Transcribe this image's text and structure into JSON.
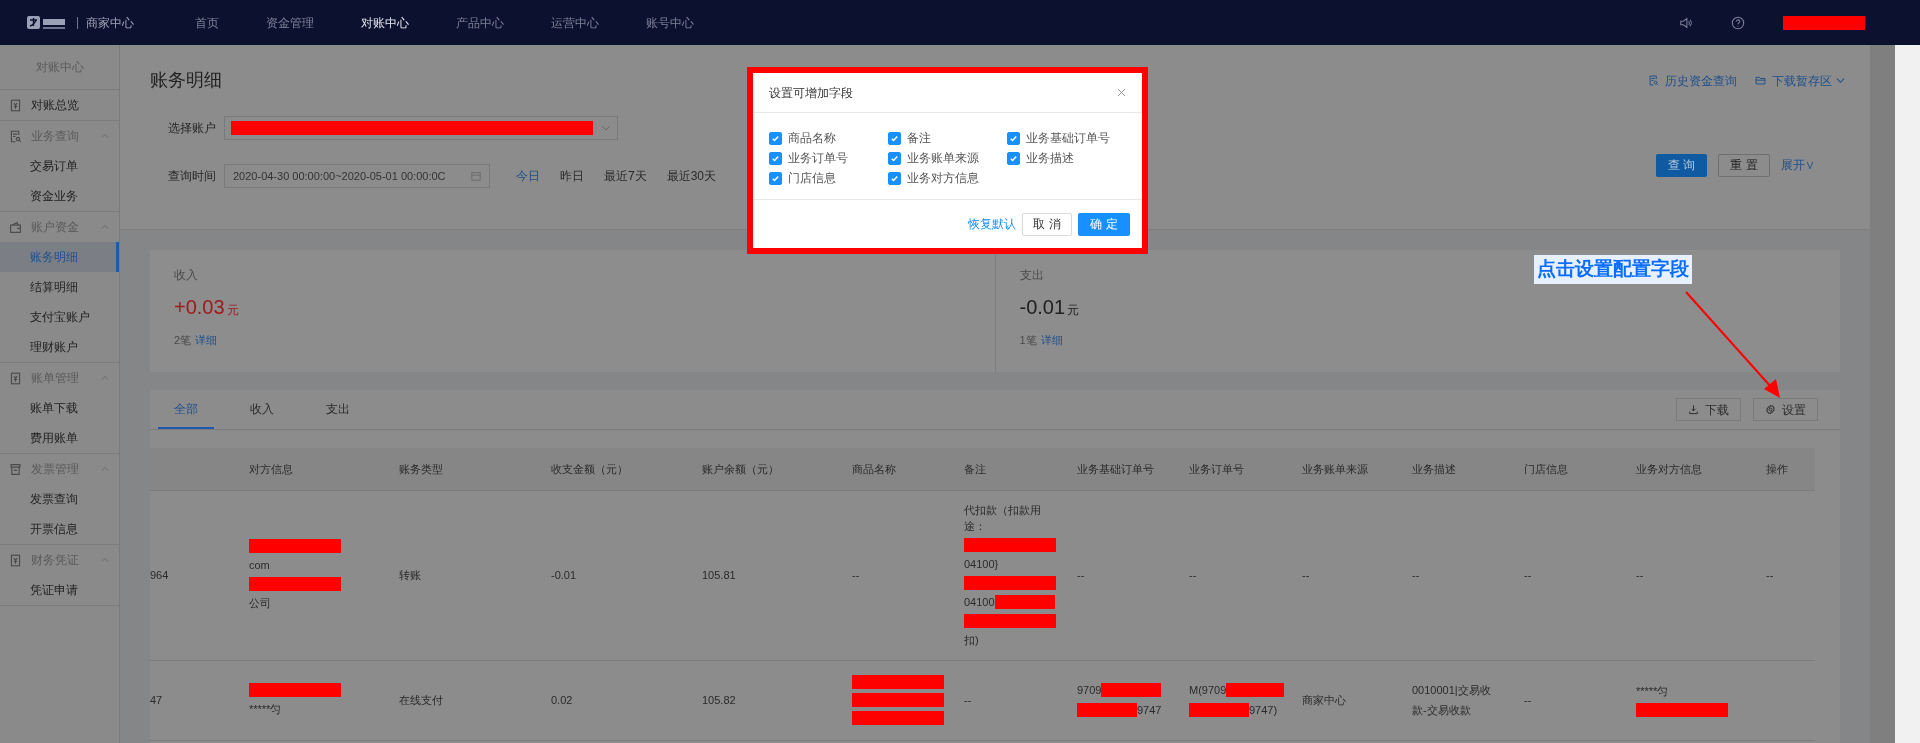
{
  "nav": {
    "brand": "商家中心",
    "items": [
      {
        "label": "首页",
        "selected": false
      },
      {
        "label": "资金管理",
        "selected": false
      },
      {
        "label": "对账中心",
        "selected": true
      },
      {
        "label": "产品中心",
        "selected": false
      },
      {
        "label": "运营中心",
        "selected": false
      },
      {
        "label": "账号中心",
        "selected": false
      }
    ],
    "user": {
      "kind": "redacted"
    }
  },
  "sidebar": {
    "title": "对账中心",
    "groups": [
      {
        "label": "对账总览"
      },
      {
        "label": "业务查询",
        "expanded": true,
        "children": [
          {
            "label": "交易订单",
            "selected": false
          },
          {
            "label": "资金业务",
            "selected": false
          }
        ]
      },
      {
        "label": "账户资金",
        "expanded": true,
        "children": [
          {
            "label": "账务明细",
            "selected": true
          },
          {
            "label": "结算明细",
            "selected": false
          },
          {
            "label": "支付宝账户",
            "selected": false
          },
          {
            "label": "理财账户",
            "selected": false
          }
        ]
      },
      {
        "label": "账单管理",
        "expanded": true,
        "children": [
          {
            "label": "账单下载",
            "selected": false
          },
          {
            "label": "费用账单",
            "selected": false
          }
        ]
      },
      {
        "label": "发票管理",
        "expanded": true,
        "children": [
          {
            "label": "发票查询",
            "selected": false
          },
          {
            "label": "开票信息",
            "selected": false
          }
        ]
      },
      {
        "label": "财务凭证",
        "expanded": true,
        "children": [
          {
            "label": "凭证申请",
            "selected": false
          }
        ]
      }
    ]
  },
  "page": {
    "title": "账务明细",
    "links": [
      {
        "label": "历史资金查询",
        "dropdown": false
      },
      {
        "label": "下载暂存区",
        "dropdown": true
      }
    ]
  },
  "filters": {
    "account_label": "选择账户",
    "account_value": {
      "kind": "redacted"
    },
    "time_label": "查询时间",
    "time_value": "2020-04-30 00:00:00~2020-05-01 00:00:0C",
    "quick_ranges": [
      {
        "label": "今日",
        "selected": true
      },
      {
        "label": "昨日",
        "selected": false
      },
      {
        "label": "最近7天",
        "selected": false
      },
      {
        "label": "最近30天",
        "selected": false
      }
    ],
    "query_button": "查 询",
    "reset_button": "重 置",
    "expand_link": "展开∨"
  },
  "summary": [
    {
      "label": "收入",
      "amount": "+0.03",
      "unit": "元",
      "kind": "income",
      "count": "2笔",
      "detail": "详细"
    },
    {
      "label": "支出",
      "amount": "-0.01",
      "unit": "元",
      "kind": "expense",
      "count": "1笔",
      "detail": "详细"
    }
  ],
  "tabs": [
    {
      "label": "全部",
      "selected": true
    },
    {
      "label": "收入",
      "selected": false
    },
    {
      "label": "支出",
      "selected": false
    }
  ],
  "actions": [
    {
      "label": "下载"
    },
    {
      "label": "设置"
    }
  ],
  "table": {
    "columns": [
      "",
      "对方信息",
      "账务类型",
      "收支金额（元）",
      "账户余额（元）",
      "商品名称",
      "备注",
      "业务基础订单号",
      "业务订单号",
      "业务账单来源",
      "业务描述",
      "门店信息",
      "业务对方信息",
      "操作"
    ],
    "rows": [
      [
        [
          [
            {
              "kind": "text",
              "text": "964"
            }
          ]
        ],
        [
          [
            {
              "kind": "redacted"
            }
          ],
          [
            {
              "kind": "text",
              "text": "com"
            }
          ],
          [
            {
              "kind": "redacted"
            }
          ],
          [
            {
              "kind": "text",
              "text": "公司"
            }
          ]
        ],
        [
          [
            {
              "kind": "text",
              "text": "转账"
            }
          ]
        ],
        [
          [
            {
              "kind": "text",
              "text": "-0.01"
            }
          ]
        ],
        [
          [
            {
              "kind": "text",
              "text": "105.81"
            }
          ]
        ],
        [
          [
            {
              "kind": "text",
              "text": "--"
            }
          ]
        ],
        [
          [
            {
              "kind": "text",
              "text": "代扣款（扣款用途："
            }
          ],
          [
            {
              "kind": "redacted"
            }
          ],
          [
            {
              "kind": "text",
              "text": "04100}"
            }
          ],
          [
            {
              "kind": "redacted"
            }
          ],
          [
            {
              "kind": "text",
              "text": "04100"
            },
            {
              "kind": "redacted"
            }
          ],
          [
            {
              "kind": "redacted"
            }
          ],
          [
            {
              "kind": "text",
              "text": "扣)"
            }
          ]
        ],
        [
          [
            {
              "kind": "text",
              "text": "--"
            }
          ]
        ],
        [
          [
            {
              "kind": "text",
              "text": "--"
            }
          ]
        ],
        [
          [
            {
              "kind": "text",
              "text": "--"
            }
          ]
        ],
        [
          [
            {
              "kind": "text",
              "text": "--"
            }
          ]
        ],
        [
          [
            {
              "kind": "text",
              "text": "--"
            }
          ]
        ],
        [
          [
            {
              "kind": "text",
              "text": "--"
            }
          ]
        ],
        [
          [
            {
              "kind": "text",
              "text": "--"
            }
          ]
        ]
      ],
      [
        [
          [
            {
              "kind": "text",
              "text": "47"
            }
          ]
        ],
        [
          [
            {
              "kind": "redacted"
            }
          ],
          [
            {
              "kind": "text",
              "text": "*****匀"
            }
          ]
        ],
        [
          [
            {
              "kind": "text",
              "text": "在线支付"
            }
          ]
        ],
        [
          [
            {
              "kind": "text",
              "text": "0.02"
            }
          ]
        ],
        [
          [
            {
              "kind": "text",
              "text": "105.82"
            }
          ]
        ],
        [
          [
            {
              "kind": "redacted"
            }
          ],
          [
            {
              "kind": "redacted"
            }
          ],
          [
            {
              "kind": "redacted"
            }
          ]
        ],
        [
          [
            {
              "kind": "text",
              "text": "--"
            }
          ]
        ],
        [
          [
            {
              "kind": "text",
              "text": "9709"
            },
            {
              "kind": "redacted"
            }
          ],
          [
            {
              "kind": "redacted"
            },
            {
              "kind": "text",
              "text": "9747"
            }
          ]
        ],
        [
          [
            {
              "kind": "text",
              "text": "M(9709"
            },
            {
              "kind": "redacted"
            }
          ],
          [
            {
              "kind": "redacted"
            },
            {
              "kind": "text",
              "text": "9747)"
            }
          ]
        ],
        [
          [
            {
              "kind": "text",
              "text": "商家中心"
            }
          ]
        ],
        [
          [
            {
              "kind": "text",
              "text": "0010001|交易收"
            }
          ],
          [
            {
              "kind": "text",
              "text": "款-交易收款"
            }
          ]
        ],
        [
          [
            {
              "kind": "text",
              "text": "--"
            }
          ]
        ],
        [
          [
            {
              "kind": "text",
              "text": "*****匀"
            }
          ],
          [
            {
              "kind": "redacted"
            }
          ]
        ],
        []
      ]
    ]
  },
  "dialog": {
    "title": "设置可增加字段",
    "options": [
      {
        "label": "商品名称",
        "checked": true
      },
      {
        "label": "备注",
        "checked": true
      },
      {
        "label": "业务基础订单号",
        "checked": true
      },
      {
        "label": "业务订单号",
        "checked": true
      },
      {
        "label": "业务账单来源",
        "checked": true
      },
      {
        "label": "业务描述",
        "checked": true
      },
      {
        "label": "门店信息",
        "checked": true
      },
      {
        "label": "业务对方信息",
        "checked": true
      }
    ],
    "restore_link": "恢复默认",
    "cancel_button": "取 消",
    "ok_button": "确 定"
  },
  "annotation": {
    "text": "点击设置配置字段"
  }
}
